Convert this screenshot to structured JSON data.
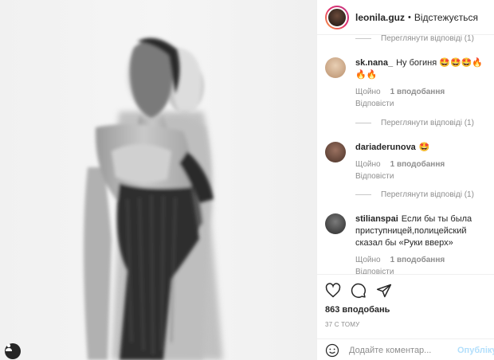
{
  "header": {
    "username": "leonila.guz",
    "separator": "•",
    "follow_status": "Відстежується"
  },
  "comments": {
    "view_replies_label": "Переглянути відповіді (1)",
    "items": [
      {
        "username": "sk.nana_",
        "text": "Ну богиня 🤩🤩🤩🔥🔥🔥",
        "time": "Щойно",
        "likes": "1 вподобання",
        "reply": "Відповісти",
        "avatar_color": "#d8b89a"
      },
      {
        "username": "dariaderunova",
        "text": "🤩",
        "time": "Щойно",
        "likes": "1 вподобання",
        "reply": "Відповісти",
        "avatar_color": "#6a4a3c"
      },
      {
        "username": "stilianspai",
        "text": "Если бы ты была приступницей,полицейский сказал бы «Руки вверх»",
        "time": "Щойно",
        "likes": "1 вподобання",
        "reply": "Відповісти",
        "avatar_color": "#3c3c3c"
      }
    ]
  },
  "actions": {
    "like_icon": "heart-icon",
    "comment_icon": "comment-icon",
    "share_icon": "share-icon",
    "likes_count": "863 вподобань",
    "time_ago": "37 С ТОМУ"
  },
  "add_comment": {
    "placeholder": "Додайте коментар...",
    "post_label": "Опублікувати"
  },
  "colors": {
    "text": "#262626",
    "muted": "#8e8e8e",
    "link_disabled": "#b2dffc",
    "border": "#efefef"
  }
}
